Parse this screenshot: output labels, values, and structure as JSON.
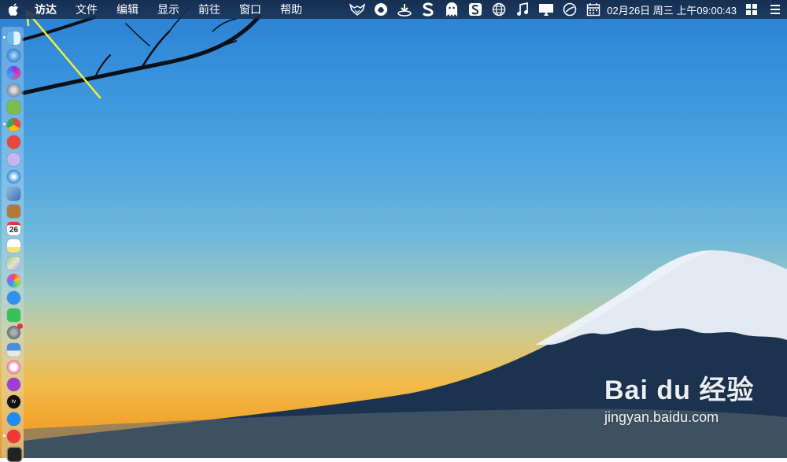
{
  "menubar": {
    "apple_icon": "apple-icon",
    "items": [
      "访达",
      "文件",
      "编辑",
      "显示",
      "前往",
      "窗口",
      "帮助"
    ],
    "clock": "02月26日 周三 上午09:00:43"
  },
  "status_icons": [
    "fox-icon",
    "browser-icon",
    "download-icon",
    "s-app-icon",
    "ghost-icon",
    "sogou-icon",
    "globe-icon",
    "music-icon",
    "display-icon",
    "speed-icon",
    "calendar-icon"
  ],
  "dock": {
    "icons": [
      "finder-icon",
      "app-store-icon",
      "siri-icon",
      "launchpad-icon",
      "android-icon",
      "chrome-icon",
      "wps-icon",
      "storage-icon",
      "safari-icon",
      "preview-icon",
      "notes-brown-icon",
      "calendar-icon",
      "notes-icon",
      "maps-icon",
      "photos-icon",
      "messages-icon",
      "wechat-icon",
      "system-preferences-icon",
      "keynote-icon",
      "itunes-icon",
      "podcasts-icon",
      "apple-tv-icon",
      "app-store-blue-icon",
      "vivaldi-icon",
      "terminal-icon"
    ],
    "calendar_day": "26",
    "tv_label": "tv"
  },
  "watermark": {
    "logo": "Bai du 经验",
    "url": "jingyan.baidu.com"
  },
  "colors": {
    "menubar": "#18304f",
    "sky_top": "#2a7ed2",
    "sky_bottom": "#f2a52e",
    "mountain": "#1c3350",
    "snow": "#eef3fb"
  }
}
